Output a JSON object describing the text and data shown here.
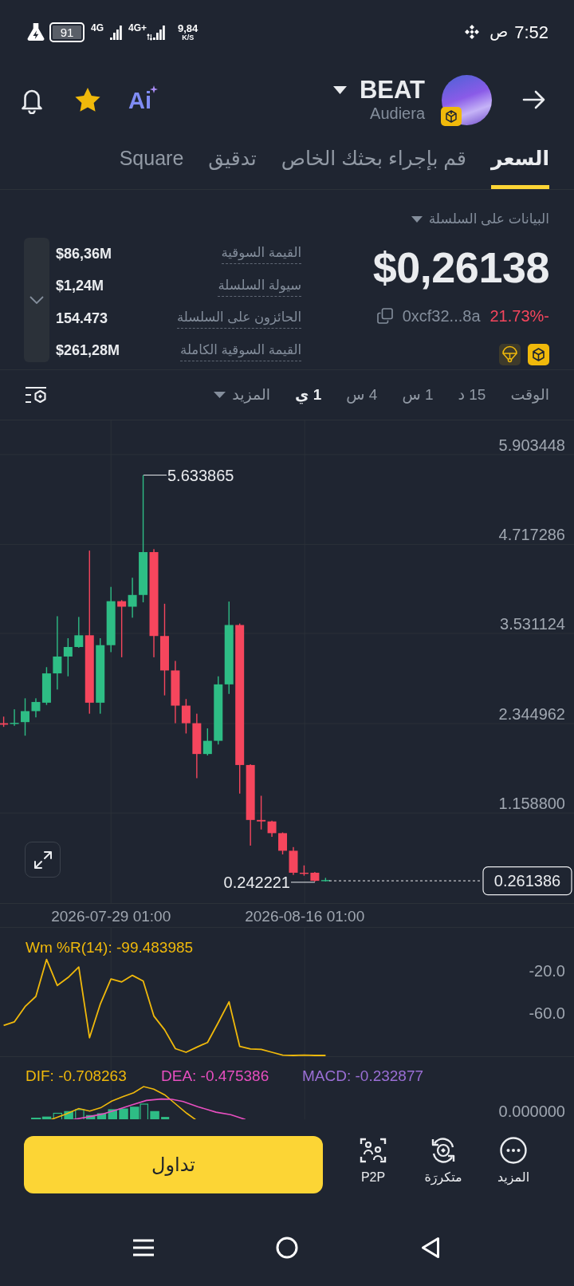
{
  "status_bar": {
    "battery": "91",
    "networks": [
      {
        "label": "4G+",
        "kind": "data"
      },
      {
        "label": "4G",
        "kind": "plain"
      }
    ],
    "speed": "9,84",
    "speed_unit": "K/S",
    "period": "ص",
    "time": "7:52"
  },
  "header": {
    "title": "BEAT",
    "subtitle": "Audiera",
    "ai_label": "Ai",
    "favorite": true
  },
  "tabs": [
    {
      "label": "السعر",
      "selected": true
    },
    {
      "label": "قم بإجراء بحثك الخاص",
      "selected": false
    },
    {
      "label": "تدقيق",
      "selected": false
    },
    {
      "label": "Square",
      "selected": false
    }
  ],
  "onchain": {
    "menu_label": "البيانات على السلسلة",
    "expanded": false,
    "stats": [
      {
        "label": "القيمة السوقية",
        "value": "$86,36M"
      },
      {
        "label": "سيولة السلسلة",
        "value": "$1,24M"
      },
      {
        "label": "الحائزون على السلسلة",
        "value": "154.473"
      },
      {
        "label": "القيمة السوقية الكاملة",
        "value": "$261,28M"
      }
    ],
    "price": "$0,26138",
    "address": "0xcf32...8a",
    "change": "21.73%-"
  },
  "intervals": [
    {
      "label": "الوقت",
      "kind": "interval",
      "selected": false
    },
    {
      "label": "15 د",
      "kind": "interval",
      "selected": false
    },
    {
      "label": "1 س",
      "kind": "interval",
      "selected": false
    },
    {
      "label": "4 س",
      "kind": "interval",
      "selected": false
    },
    {
      "label": "1 ي",
      "kind": "interval",
      "selected": true
    },
    {
      "label": "المزيد",
      "kind": "dropdown",
      "selected": false
    }
  ],
  "price_chart": {
    "y_ticks": [
      "5.903448",
      "4.717286",
      "3.531124",
      "2.344962",
      "1.158800"
    ],
    "high": "5.633865",
    "low": "0.242221",
    "last_price": "0.261386",
    "dates": [
      "2026-08-16 01:00",
      "2026-07-29 01:00"
    ]
  },
  "williams_r": {
    "chart_data": {
      "type": "line",
      "title": "Wm %R(14): -99.483985",
      "categories": [
        null,
        null,
        null,
        null,
        null,
        null,
        null,
        null,
        null,
        null,
        null,
        null,
        null,
        null,
        null,
        null,
        null,
        null,
        null,
        null,
        null,
        null,
        null,
        null,
        null,
        null,
        null,
        null,
        null,
        null,
        null
      ],
      "series": [
        {
          "color": "#f0b90b",
          "values": [
            -71.2,
            -67.8,
            -53.6,
            -44.1,
            -9.5,
            -33.9,
            -26.4,
            -16.6,
            -82.7,
            -51.5,
            -27.8,
            -30.5,
            -24.4,
            -29.8,
            -62.4,
            -75.3,
            -92.9,
            -96.3,
            -91.5,
            -87.1,
            -68.5,
            -49.2,
            -90.8,
            -93.2,
            -93.6,
            -96.3,
            -99.0,
            -99.7,
            -99.0,
            -99.7,
            -99.5
          ]
        }
      ],
      "ylim": [
        -100,
        20
      ],
      "yticks": [
        {
          "value": -20,
          "label": "-20.0"
        },
        {
          "value": -60,
          "label": "-60.0"
        }
      ]
    }
  },
  "macd": {
    "legend": [
      {
        "text": "MACD: -0.232877",
        "color": "#9b6fd6"
      },
      {
        "text": "DEA: -0.475386",
        "color": "#e84fc0"
      },
      {
        "text": "DIF: -0.708263",
        "color": "#f0b90b"
      }
    ],
    "tick": "0.000000"
  },
  "actions": {
    "shortcuts": [
      {
        "label": "المزيد",
        "kind": "more"
      },
      {
        "label": "متكررَة",
        "kind": "recurring"
      },
      {
        "label": "P2P",
        "kind": "p2p"
      }
    ],
    "trade": "تداول"
  }
}
